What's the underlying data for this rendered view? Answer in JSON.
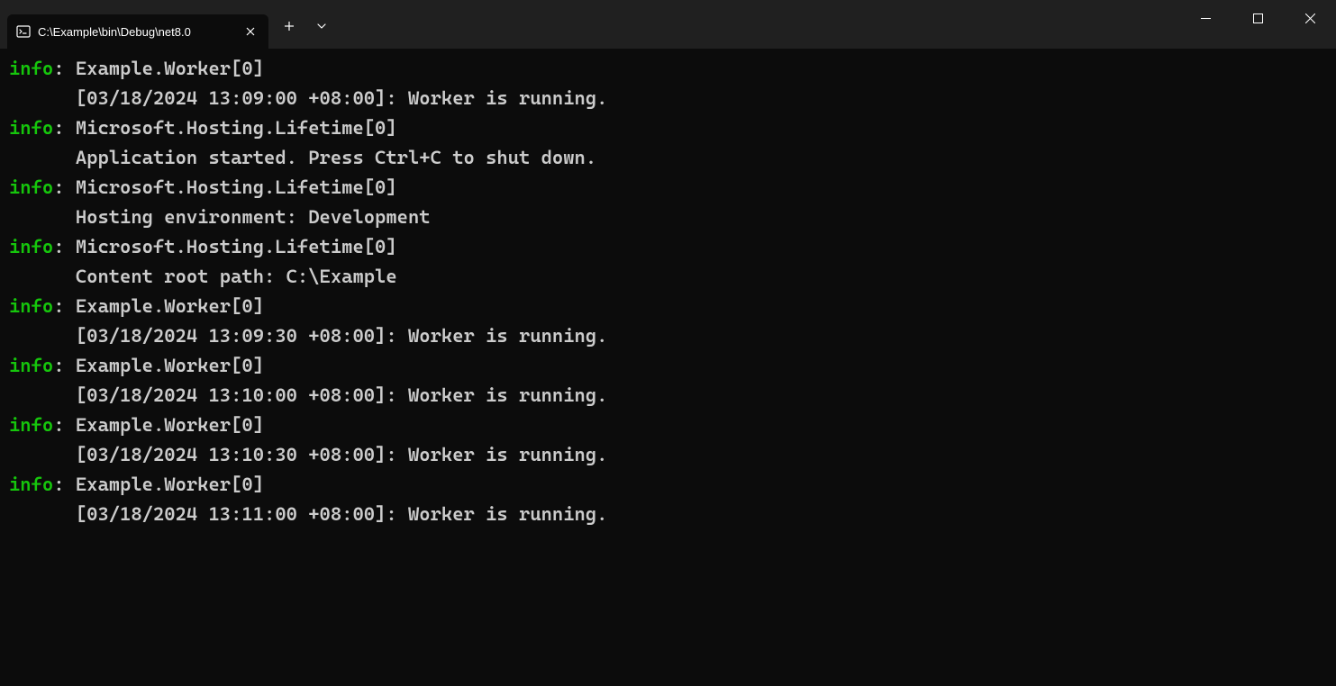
{
  "titlebar": {
    "tab_title": "C:\\Example\\bin\\Debug\\net8.0",
    "new_tab_label": "+",
    "dropdown_label": "⌄"
  },
  "colors": {
    "info_level": "#16c60c",
    "text": "#cccccc",
    "background": "#0c0c0c",
    "titlebar": "#202020"
  },
  "log_entries": [
    {
      "level": "info",
      "source": "Example.Worker[0]",
      "message": "[03/18/2024 13:09:00 +08:00]: Worker is running."
    },
    {
      "level": "info",
      "source": "Microsoft.Hosting.Lifetime[0]",
      "message": "Application started. Press Ctrl+C to shut down."
    },
    {
      "level": "info",
      "source": "Microsoft.Hosting.Lifetime[0]",
      "message": "Hosting environment: Development"
    },
    {
      "level": "info",
      "source": "Microsoft.Hosting.Lifetime[0]",
      "message": "Content root path: C:\\Example"
    },
    {
      "level": "info",
      "source": "Example.Worker[0]",
      "message": "[03/18/2024 13:09:30 +08:00]: Worker is running."
    },
    {
      "level": "info",
      "source": "Example.Worker[0]",
      "message": "[03/18/2024 13:10:00 +08:00]: Worker is running."
    },
    {
      "level": "info",
      "source": "Example.Worker[0]",
      "message": "[03/18/2024 13:10:30 +08:00]: Worker is running."
    },
    {
      "level": "info",
      "source": "Example.Worker[0]",
      "message": "[03/18/2024 13:11:00 +08:00]: Worker is running."
    }
  ]
}
